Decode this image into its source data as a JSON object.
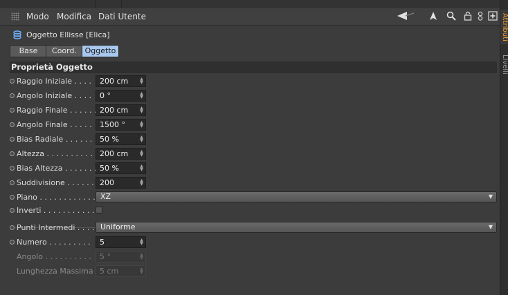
{
  "menubar": {
    "items": [
      "Modo",
      "Modifica",
      "Dati Utente"
    ],
    "tools": [
      "back-arrow-icon",
      "cursor-icon",
      "search-icon",
      "lock-icon",
      "link-icon",
      "new-panel-icon"
    ]
  },
  "object": {
    "title": "Oggetto Ellisse [Elica]",
    "icon": "helix-icon"
  },
  "tabs": [
    {
      "label": "Base",
      "active": false
    },
    {
      "label": "Coord.",
      "active": false
    },
    {
      "label": "Oggetto",
      "active": true
    }
  ],
  "section_title": "Proprietà Oggetto",
  "properties": [
    {
      "label": "Raggio Iniziale . . . .",
      "value": "200 cm"
    },
    {
      "label": "Angolo Iniziale  . . . .",
      "value": "0 °"
    },
    {
      "label": "Raggio Finale . . . . . .",
      "value": "200 cm"
    },
    {
      "label": "Angolo Finale  . . . . .",
      "value": "1500 °"
    },
    {
      "label": "Bias Radiale  . . . . . . .",
      "value": "50 %"
    },
    {
      "label": "Altezza . . . . . . . . . . .",
      "value": "200 cm"
    },
    {
      "label": "Bias Altezza . . . . . . .",
      "value": "50 %"
    },
    {
      "label": "Suddivisione  . . . . . .",
      "value": "200"
    }
  ],
  "piano": {
    "label": "Piano . . . . . . . . . . . .",
    "value": "XZ"
  },
  "inverti": {
    "label": "Inverti . . . . . . . . . . .",
    "checked": false
  },
  "punti": {
    "label": "Punti Intermedi . . . .",
    "value": "Uniforme"
  },
  "numero": {
    "label": "Numero  . . . . . . . . .",
    "value": "5"
  },
  "angolo": {
    "label": "Angolo  . . . . . . . . . .",
    "value": "5 °"
  },
  "lunghezza": {
    "label": "Lunghezza Massima",
    "value": "5 cm"
  },
  "side_tabs": [
    "Attributi",
    "Livelli"
  ],
  "colors": {
    "accent": "#f0a030",
    "active_tab": "#a8c8ee",
    "bg": "#3c3c3c"
  }
}
